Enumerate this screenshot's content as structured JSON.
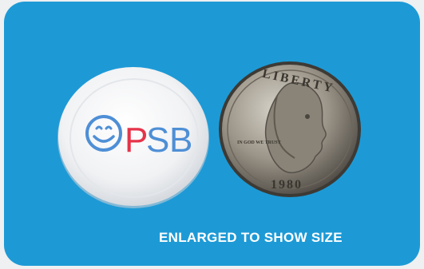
{
  "photo": {
    "background_color": "#1d9ad6",
    "badge": {
      "logo_letters": [
        "O",
        "P",
        "S",
        "B"
      ],
      "logo_colors": {
        "smiley": "#4e8fd6",
        "P": "#e5344a",
        "S": "#4e8fd6",
        "B": "#4e8fd6"
      }
    },
    "coin": {
      "inscription": "LIBERTY",
      "motto": "IN GOD WE TRUST",
      "year": "1980"
    },
    "caption": "ENLARGED TO SHOW SIZE"
  }
}
